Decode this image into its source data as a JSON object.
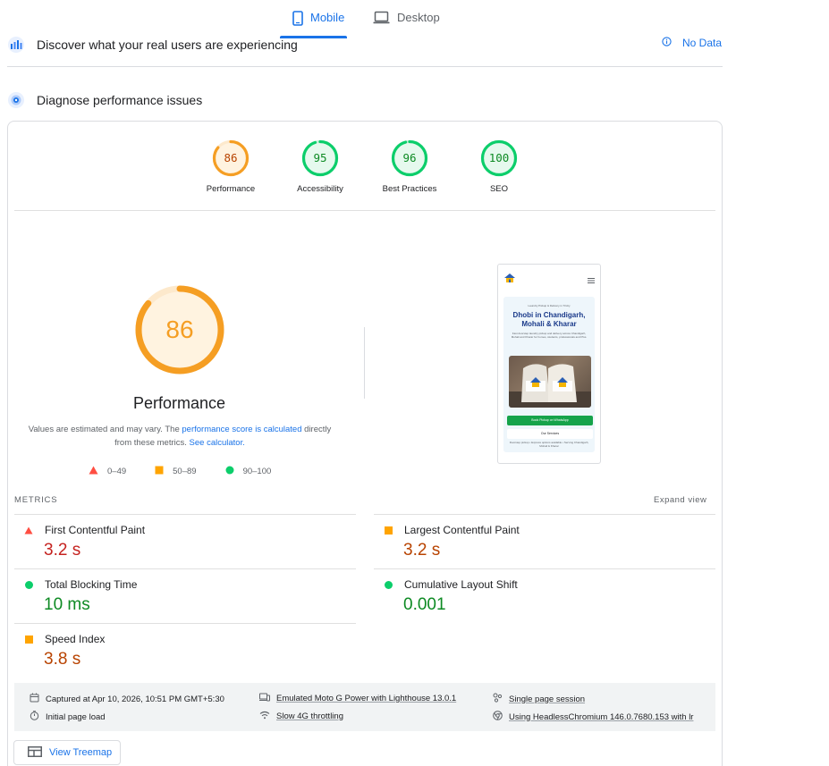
{
  "tabs": [
    {
      "label": "Mobile",
      "active": true
    },
    {
      "label": "Desktop",
      "active": false
    }
  ],
  "discover": {
    "title": "Discover what your real users are experiencing",
    "no_data": "No Data"
  },
  "diagnose": {
    "title": "Diagnose performance issues"
  },
  "gauges": [
    {
      "label": "Performance",
      "score": "86",
      "fraction": 0.86,
      "color": "#f59e23",
      "text_color": "#b84300"
    },
    {
      "label": "Accessibility",
      "score": "95",
      "fraction": 0.95,
      "color": "#0cce6b",
      "text_color": "#0d8a23"
    },
    {
      "label": "Best Practices",
      "score": "96",
      "fraction": 0.96,
      "color": "#0cce6b",
      "text_color": "#0d8a23"
    },
    {
      "label": "SEO",
      "score": "100",
      "fraction": 1.0,
      "color": "#0cce6b",
      "text_color": "#0d8a23"
    }
  ],
  "performance": {
    "score": "86",
    "fraction": 0.86,
    "title": "Performance",
    "desc_prefix": "Values are estimated and may vary. The ",
    "desc_link1": "performance score is calculated",
    "desc_mid": " directly from these metrics. ",
    "desc_link2": "See calculator."
  },
  "legend": [
    {
      "shape": "triangle",
      "range": "0–49",
      "color": "#ff4e42"
    },
    {
      "shape": "square",
      "range": "50–89",
      "color": "#ffa400"
    },
    {
      "shape": "circle",
      "range": "90–100",
      "color": "#0cce6b"
    }
  ],
  "phone": {
    "small_top": "Laundry Pickup & Delivery in Tricity",
    "title": "Dhobi in Chandigarh, Mohali & Kharar",
    "subtitle": "Fast doorstep laundry pickup and delivery across Chandigarh, Mohali and Kharar for homes, students, professionals and PGs.",
    "btn1": "Book Pickup on WhatsApp",
    "btn2": "Our Services",
    "footer": "Doorstep pickup • Express options available • Serving Chandigarh, Mohali & Kharar"
  },
  "metrics": {
    "label": "METRICS",
    "expand": "Expand view",
    "items": [
      {
        "name": "First Contentful Paint",
        "value": "3.2 s",
        "rating": "red"
      },
      {
        "name": "Largest Contentful Paint",
        "value": "3.2 s",
        "rating": "orange"
      },
      {
        "name": "Total Blocking Time",
        "value": "10 ms",
        "rating": "green"
      },
      {
        "name": "Cumulative Layout Shift",
        "value": "0.001",
        "rating": "green"
      },
      {
        "name": "Speed Index",
        "value": "3.8 s",
        "rating": "orange"
      }
    ]
  },
  "info": {
    "captured": "Captured at Apr 10, 2026, 10:51 PM GMT+5:30",
    "initial": "Initial page load",
    "device": "Emulated Moto G Power with Lighthouse 13.0.1",
    "throttling": "Slow 4G throttling",
    "session": "Single page session",
    "browser": "Using HeadlessChromium 146.0.7680.153 with lr"
  },
  "treemap": {
    "label": "View Treemap"
  }
}
